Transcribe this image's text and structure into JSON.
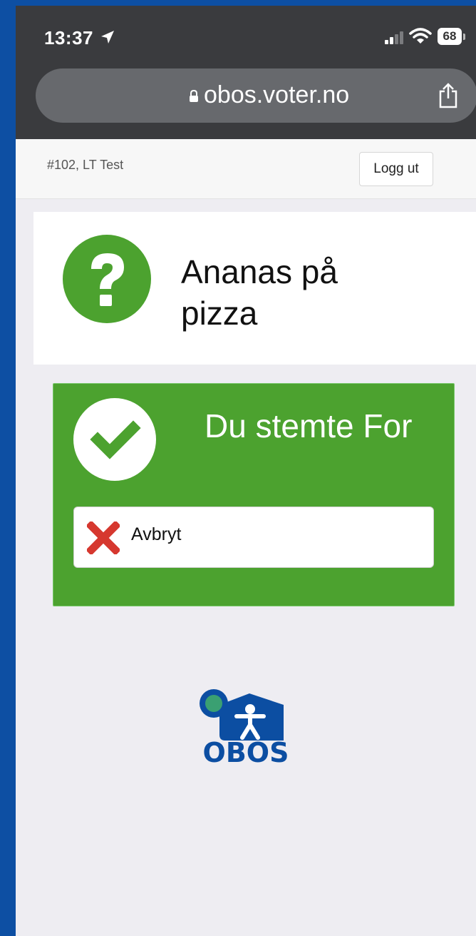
{
  "status_bar": {
    "time": "13:37",
    "battery": "68",
    "icons": [
      "location-arrow-icon",
      "signal-icon",
      "wifi-icon",
      "battery-icon"
    ]
  },
  "browser": {
    "url": "obos.voter.no",
    "icons": [
      "lock-icon",
      "share-icon"
    ]
  },
  "header": {
    "unit": "#102, LT Test",
    "logout_label": "Logg ut"
  },
  "question": {
    "title": "Ananas på pizza",
    "icon": "question-mark-icon",
    "color": "#4ca22f"
  },
  "vote": {
    "status": "Du stemte For",
    "cancel_label": "Avbryt",
    "icons": [
      "checkmark-icon",
      "x-icon"
    ],
    "panel_color": "#4ca22f",
    "cancel_icon_color": "#d6382f"
  },
  "footer": {
    "brand": "OBOS",
    "brand_color": "#0c4ea2",
    "accent_color": "#3aa072"
  }
}
